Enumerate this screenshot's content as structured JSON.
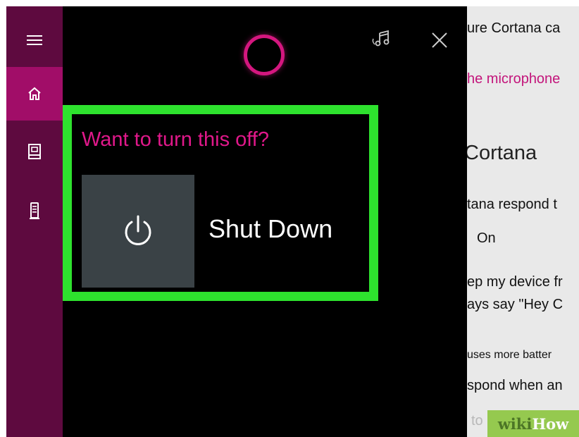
{
  "rail": {
    "items": [
      {
        "icon": "hamburger-menu-icon"
      },
      {
        "icon": "home-icon",
        "active": true
      },
      {
        "icon": "notebook-icon"
      },
      {
        "icon": "device-icon"
      }
    ]
  },
  "panel": {
    "header_icons": [
      "cortana-ring-icon",
      "music-icon",
      "close-icon"
    ],
    "prompt": "Want to turn this off?",
    "action": {
      "icon": "power-icon",
      "label": "Shut Down"
    }
  },
  "settings": {
    "line1": "ure Cortana ca",
    "link": "he microphone",
    "heading": "Cortana",
    "line3": "tana respond t",
    "toggle_value": "On",
    "line5": "ep my device fr",
    "line6": "ays say \"Hey C",
    "line7": "uses more batter",
    "line8": "spond when an",
    "line9": "to"
  },
  "watermark": {
    "wiki": "wiki",
    "how": "How"
  },
  "colors": {
    "accent": "#e0188a",
    "rail": "#5e0a3f",
    "rail_active": "#a10d68",
    "highlight": "#2ee22e",
    "tile": "#3a4246"
  }
}
